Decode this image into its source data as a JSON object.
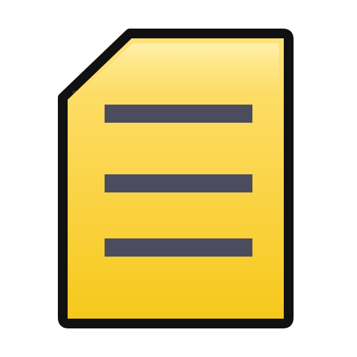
{
  "icon": {
    "name": "document-icon",
    "line_count": 3
  },
  "colors": {
    "page_fill_top": "#FFE27A",
    "page_fill_bottom": "#F6C81A",
    "outline": "#111111",
    "lines": "#4B4D5E",
    "background": "#FFFFFF"
  }
}
